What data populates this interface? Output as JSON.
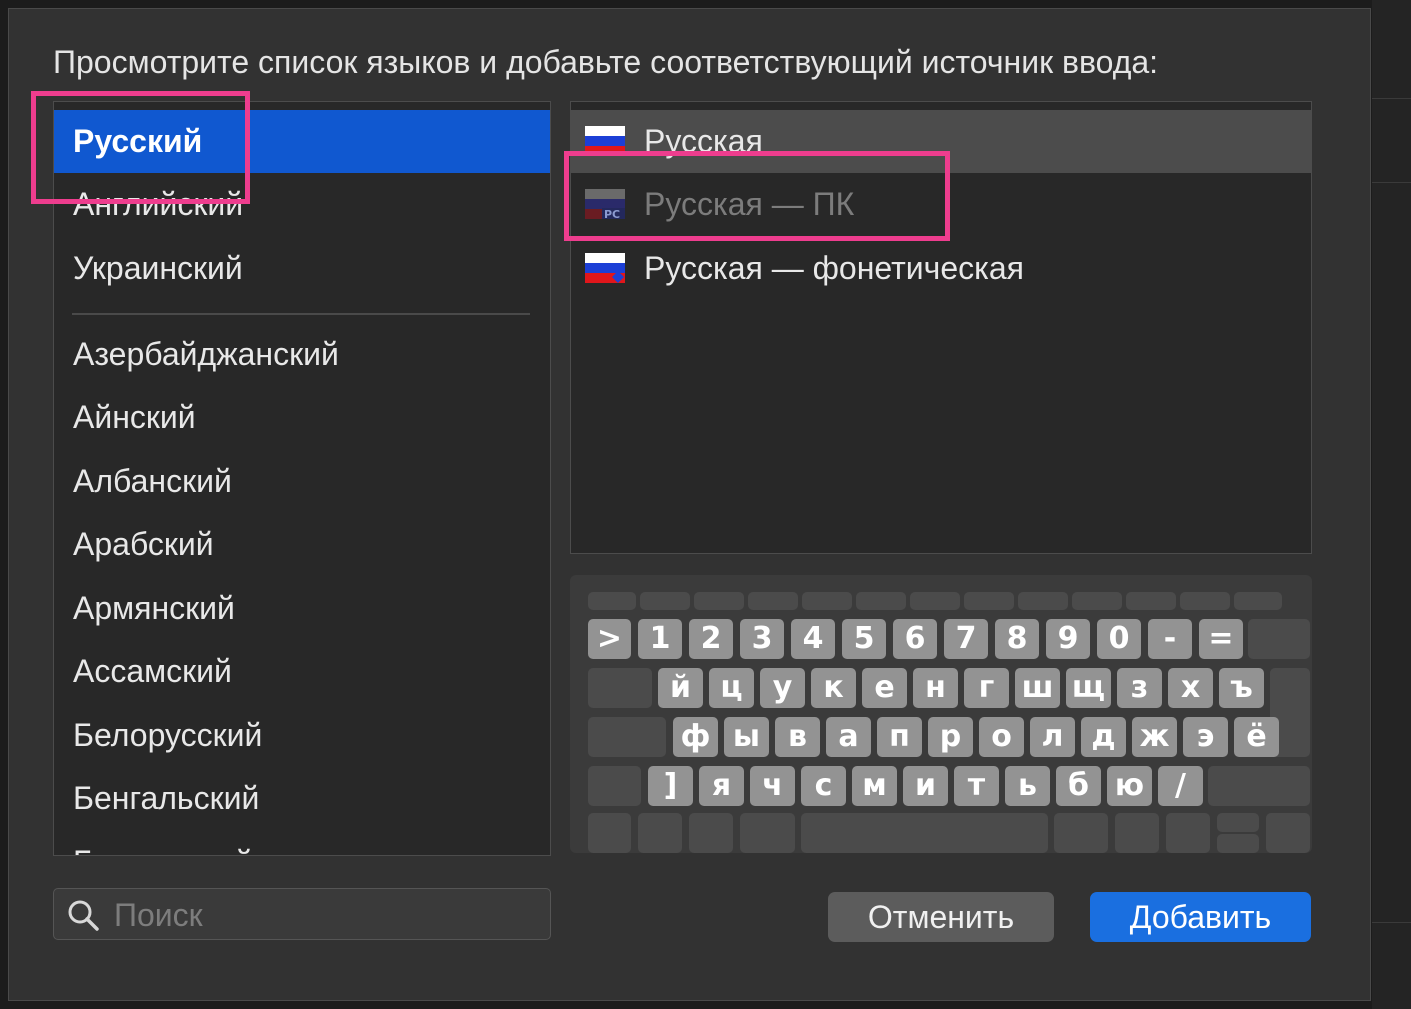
{
  "prompt": "Просмотрите список языков и добавьте соответствующий источник ввода:",
  "languages": {
    "pinned": [
      "Русский",
      "Английский",
      "Украинский"
    ],
    "all": [
      "Азербайджанский",
      "Айнский",
      "Албанский",
      "Арабский",
      "Армянский",
      "Ассамский",
      "Белорусский",
      "Бенгальский",
      "Бирманский"
    ],
    "selected": "Русский"
  },
  "sources": [
    {
      "label": "Русская",
      "state": "selected",
      "icon": "russia-flag-icon"
    },
    {
      "label": "Русская — ПК",
      "state": "disabled",
      "icon": "russia-flag-pc-icon",
      "badge": "PC"
    },
    {
      "label": "Русская — фонетическая",
      "state": "normal",
      "icon": "russia-flag-phonetic-icon"
    }
  ],
  "keyboard_rows": [
    [
      ">",
      "1",
      "2",
      "3",
      "4",
      "5",
      "6",
      "7",
      "8",
      "9",
      "0",
      "-",
      "="
    ],
    [
      "й",
      "ц",
      "у",
      "к",
      "е",
      "н",
      "г",
      "ш",
      "щ",
      "з",
      "х",
      "ъ"
    ],
    [
      "ф",
      "ы",
      "в",
      "а",
      "п",
      "р",
      "о",
      "л",
      "д",
      "ж",
      "э",
      "ё"
    ],
    [
      "]",
      "я",
      "ч",
      "с",
      "м",
      "и",
      "т",
      "ь",
      "б",
      "ю",
      "/"
    ]
  ],
  "search": {
    "placeholder": "Поиск",
    "value": ""
  },
  "buttons": {
    "cancel": "Отменить",
    "add": "Добавить"
  },
  "colors": {
    "selection": "#1058d0",
    "accent_button": "#1a6fe0",
    "annotation": "#ee3d8e"
  }
}
